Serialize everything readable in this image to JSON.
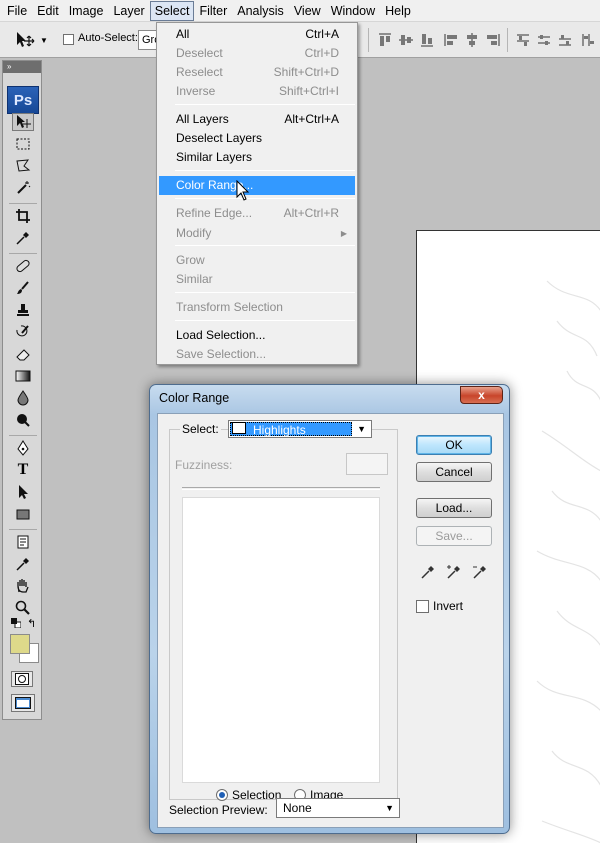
{
  "menubar": {
    "items": [
      "File",
      "Edit",
      "Image",
      "Layer",
      "Select",
      "Filter",
      "Analysis",
      "View",
      "Window",
      "Help"
    ],
    "active": "Select"
  },
  "options_bar": {
    "auto_select_label": "Auto-Select:",
    "auto_select_value": "Gro"
  },
  "tools_panel": {
    "logo": "Ps",
    "foreground_color": "#ded98a",
    "background_color": "#ffffff"
  },
  "select_menu": {
    "items": [
      {
        "label": "All",
        "shortcut": "Ctrl+A",
        "enabled": true
      },
      {
        "label": "Deselect",
        "shortcut": "Ctrl+D",
        "enabled": false
      },
      {
        "label": "Reselect",
        "shortcut": "Shift+Ctrl+D",
        "enabled": false
      },
      {
        "label": "Inverse",
        "shortcut": "Shift+Ctrl+I",
        "enabled": false
      },
      {
        "label": "All Layers",
        "shortcut": "Alt+Ctrl+A",
        "enabled": true
      },
      {
        "label": "Deselect Layers",
        "shortcut": "",
        "enabled": true
      },
      {
        "label": "Similar Layers",
        "shortcut": "",
        "enabled": true
      },
      {
        "label": "Color Range...",
        "shortcut": "",
        "enabled": true,
        "highlighted": true
      },
      {
        "label": "Refine Edge...",
        "shortcut": "Alt+Ctrl+R",
        "enabled": false
      },
      {
        "label": "Modify",
        "shortcut": "",
        "enabled": false,
        "submenu": true
      },
      {
        "label": "Grow",
        "shortcut": "",
        "enabled": false
      },
      {
        "label": "Similar",
        "shortcut": "",
        "enabled": false
      },
      {
        "label": "Transform Selection",
        "shortcut": "",
        "enabled": false
      },
      {
        "label": "Load Selection...",
        "shortcut": "",
        "enabled": true
      },
      {
        "label": "Save Selection...",
        "shortcut": "",
        "enabled": false
      }
    ]
  },
  "color_range_dialog": {
    "title": "Color Range",
    "close_label": "x",
    "select_label": "Select:",
    "select_value": "Highlights",
    "fuzziness_label": "Fuzziness:",
    "radio_selection": "Selection",
    "radio_image": "Image",
    "radio_selected": "Selection",
    "preview_label": "Selection Preview:",
    "preview_value": "None",
    "ok": "OK",
    "cancel": "Cancel",
    "load": "Load...",
    "save": "Save...",
    "invert": "Invert",
    "accent_color": "#3399ff"
  }
}
